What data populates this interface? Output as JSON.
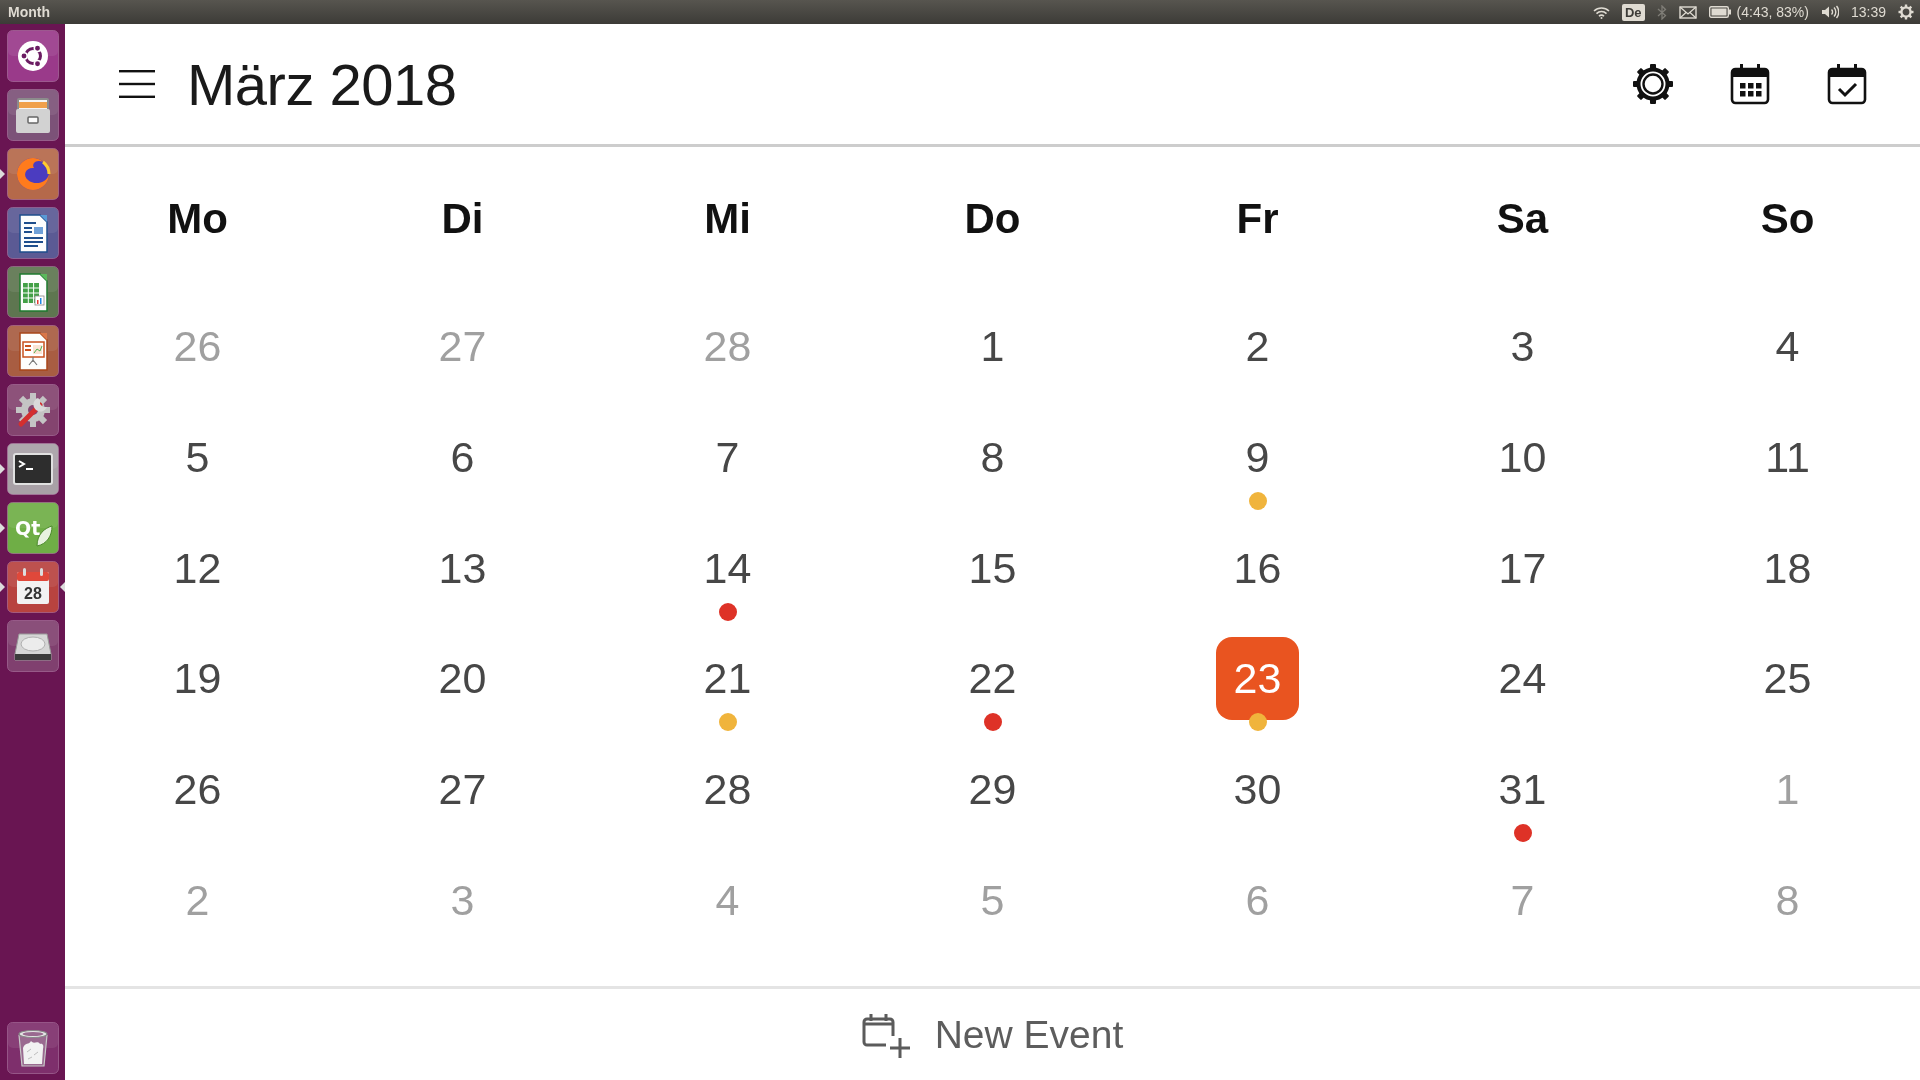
{
  "topbar": {
    "title": "Month",
    "indicators": [
      {
        "kind": "wifi",
        "dimmed": false
      },
      {
        "kind": "keyboard",
        "text": "De",
        "dimmed": false
      },
      {
        "kind": "bluetooth",
        "dimmed": true
      },
      {
        "kind": "mail",
        "dimmed": false
      },
      {
        "kind": "battery",
        "text": "(4:43, 83%)",
        "dimmed": false
      },
      {
        "kind": "volume",
        "dimmed": false
      },
      {
        "kind": "clock",
        "text": "13:39",
        "dimmed": false
      },
      {
        "kind": "session",
        "dimmed": false
      }
    ]
  },
  "launcher": {
    "items": [
      {
        "kind": "dash",
        "running": false,
        "focused": false
      },
      {
        "kind": "files",
        "running": false,
        "focused": false
      },
      {
        "kind": "browser",
        "running": true,
        "focused": false
      },
      {
        "kind": "writer",
        "running": false,
        "focused": false
      },
      {
        "kind": "calc",
        "running": false,
        "focused": false
      },
      {
        "kind": "impress",
        "running": false,
        "focused": false
      },
      {
        "kind": "settings",
        "running": false,
        "focused": false
      },
      {
        "kind": "terminal",
        "running": true,
        "focused": false
      },
      {
        "kind": "qt",
        "label": "Qt",
        "running": true,
        "focused": false
      },
      {
        "kind": "calendar",
        "label": "28",
        "running": true,
        "focused": true
      },
      {
        "kind": "drive",
        "running": false,
        "focused": false
      },
      {
        "kind": "trash",
        "running": false,
        "focused": false
      }
    ]
  },
  "header": {
    "title": "März 2018",
    "actions": [
      {
        "kind": "settings"
      },
      {
        "kind": "month_view"
      },
      {
        "kind": "agenda"
      }
    ]
  },
  "weekdays": [
    "Mo",
    "Di",
    "Mi",
    "Do",
    "Fr",
    "Sa",
    "So"
  ],
  "weeks": [
    {
      "days": [
        {
          "day": "26",
          "other_month": true,
          "selected": false
        },
        {
          "day": "27",
          "other_month": true,
          "selected": false
        },
        {
          "day": "28",
          "other_month": true,
          "selected": false
        },
        {
          "day": "1",
          "other_month": false,
          "selected": false
        },
        {
          "day": "2",
          "other_month": false,
          "selected": false
        },
        {
          "day": "3",
          "other_month": false,
          "selected": false
        },
        {
          "day": "4",
          "other_month": false,
          "selected": false
        }
      ]
    },
    {
      "days": [
        {
          "day": "5",
          "other_month": false,
          "selected": false
        },
        {
          "day": "6",
          "other_month": false,
          "selected": false
        },
        {
          "day": "7",
          "other_month": false,
          "selected": false
        },
        {
          "day": "8",
          "other_month": false,
          "selected": false
        },
        {
          "day": "9",
          "other_month": false,
          "selected": false,
          "events": [
            {
              "color": "#f0b43c"
            }
          ]
        },
        {
          "day": "10",
          "other_month": false,
          "selected": false
        },
        {
          "day": "11",
          "other_month": false,
          "selected": false
        }
      ]
    },
    {
      "days": [
        {
          "day": "12",
          "other_month": false,
          "selected": false
        },
        {
          "day": "13",
          "other_month": false,
          "selected": false
        },
        {
          "day": "14",
          "other_month": false,
          "selected": false,
          "events": [
            {
              "color": "#de3227"
            }
          ]
        },
        {
          "day": "15",
          "other_month": false,
          "selected": false
        },
        {
          "day": "16",
          "other_month": false,
          "selected": false
        },
        {
          "day": "17",
          "other_month": false,
          "selected": false
        },
        {
          "day": "18",
          "other_month": false,
          "selected": false
        }
      ]
    },
    {
      "days": [
        {
          "day": "19",
          "other_month": false,
          "selected": false
        },
        {
          "day": "20",
          "other_month": false,
          "selected": false
        },
        {
          "day": "21",
          "other_month": false,
          "selected": false,
          "events": [
            {
              "color": "#f0b43c"
            }
          ]
        },
        {
          "day": "22",
          "other_month": false,
          "selected": false,
          "events": [
            {
              "color": "#de3227"
            }
          ]
        },
        {
          "day": "23",
          "other_month": false,
          "selected": true,
          "events": [
            {
              "color": "#f0b43c"
            }
          ]
        },
        {
          "day": "24",
          "other_month": false,
          "selected": false
        },
        {
          "day": "25",
          "other_month": false,
          "selected": false
        }
      ]
    },
    {
      "days": [
        {
          "day": "26",
          "other_month": false,
          "selected": false
        },
        {
          "day": "27",
          "other_month": false,
          "selected": false
        },
        {
          "day": "28",
          "other_month": false,
          "selected": false
        },
        {
          "day": "29",
          "other_month": false,
          "selected": false
        },
        {
          "day": "30",
          "other_month": false,
          "selected": false
        },
        {
          "day": "31",
          "other_month": false,
          "selected": false,
          "events": [
            {
              "color": "#de3227"
            }
          ]
        },
        {
          "day": "1",
          "other_month": true,
          "selected": false
        }
      ]
    },
    {
      "days": [
        {
          "day": "2",
          "other_month": true,
          "selected": false
        },
        {
          "day": "3",
          "other_month": true,
          "selected": false
        },
        {
          "day": "4",
          "other_month": true,
          "selected": false
        },
        {
          "day": "5",
          "other_month": true,
          "selected": false
        },
        {
          "day": "6",
          "other_month": true,
          "selected": false
        },
        {
          "day": "7",
          "other_month": true,
          "selected": false
        },
        {
          "day": "8",
          "other_month": true,
          "selected": false
        }
      ]
    }
  ],
  "footer": {
    "new_event": {
      "label": "New Event"
    }
  }
}
